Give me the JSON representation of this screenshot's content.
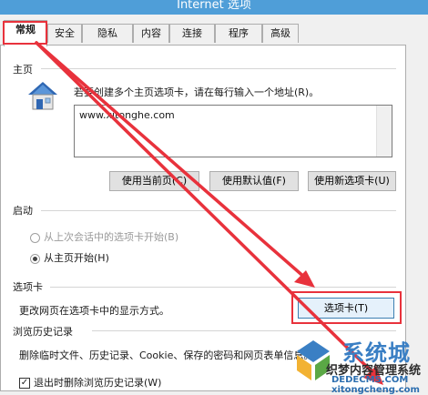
{
  "window": {
    "title": "Internet 选项"
  },
  "tabs": [
    "常规",
    "安全",
    "隐私",
    "内容",
    "连接",
    "程序",
    "高级"
  ],
  "home": {
    "section": "主页",
    "description": "若要创建多个主页选项卡，请在每行输入一个地址(R)。",
    "url": "www.xitonghe.com",
    "buttons": {
      "current": "使用当前页(C)",
      "default": "使用默认值(F)",
      "new_tab": "使用新选项卡(U)"
    }
  },
  "startup": {
    "section": "启动",
    "option_last": "从上次会话中的选项卡开始(B)",
    "option_home": "从主页开始(H)"
  },
  "tabs_section": {
    "section": "选项卡",
    "description": "更改网页在选项卡中的显示方式。",
    "button": "选项卡(T)"
  },
  "history": {
    "section": "浏览历史记录",
    "description": "删除临时文件、历史记录、Cookie、保存的密码和网页表单信息。",
    "checkbox": "退出时删除浏览历史记录(W)"
  },
  "watermark": {
    "main": "系统城",
    "sub": "织梦内容管理系统",
    "url1": "DEDECMS.COM",
    "url2": "xitongcheng.com"
  },
  "colors": {
    "annotation": "#e8323c",
    "titlebar": "#4f9ed8",
    "watermark": "#3a7fc4"
  }
}
